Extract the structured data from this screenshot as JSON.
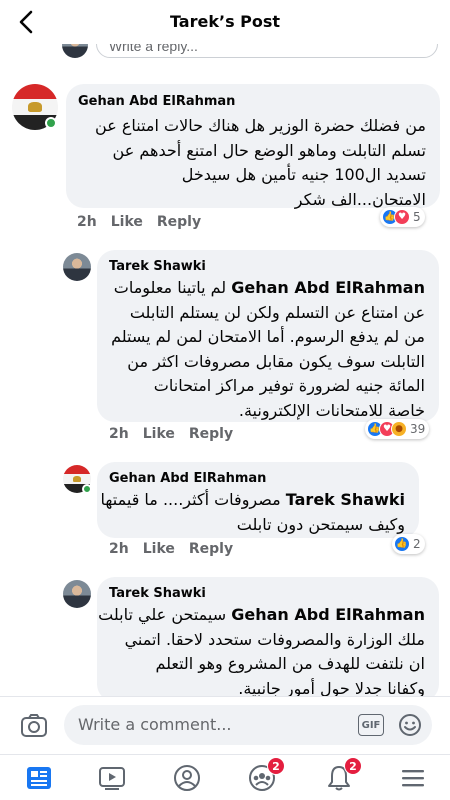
{
  "header": {
    "title": "Tarek’s Post"
  },
  "reply_box": {
    "placeholder": "Write a reply..."
  },
  "comments": [
    {
      "author": "Gehan Abd ElRahman",
      "lines": [
        "من فضلك حضرة الوزير هل هناك حالات امتناع عن",
        "تسلم التابلت وماهو الوضع حال امتنع أحدهم عن",
        "تسديد ال100 جنيه تأمين هل سيدخل",
        "الامتحان...الف شكر"
      ],
      "time": "2h",
      "like": "Like",
      "reply": "Reply",
      "reactions": "5"
    },
    {
      "author": "Tarek Shawki",
      "tag": "Gehan Abd ElRahman",
      "first_line_rest": " لم ياتينا معلومات",
      "lines": [
        "عن امتناع عن التسلم ولكن لن يستلم التابلت",
        "من لم يدفع الرسوم. أما الامتحان لمن لم يستلم",
        "التابلت سوف يكون مقابل مصروفات اكثر من",
        "المائة جنيه لضرورة توفير مراكز امتحانات",
        "خاصة للامتحانات الإلكترونية."
      ],
      "time": "2h",
      "like": "Like",
      "reply": "Reply",
      "reactions": "39"
    },
    {
      "author": "Gehan Abd ElRahman",
      "tag": "Tarek Shawki",
      "first_line_rest": "  مصروفات أكثر.... ما قيمتها",
      "lines": [
        "وكيف سيمتحن دون تابلت"
      ],
      "time": "2h",
      "like": "Like",
      "reply": "Reply",
      "reactions": "2"
    },
    {
      "author": "Tarek Shawki",
      "tag": "Gehan Abd ElRahman",
      "first_line_rest": " سيمتحن علي تابلت",
      "lines": [
        "ملك الوزارة والمصروفات ستحدد لاحقا. اتمني",
        "ان نلتفت للهدف من المشروع وهو التعلم",
        "وكفانا جدلا حول أمور جانبية."
      ]
    }
  ],
  "composer": {
    "placeholder": "Write a comment...",
    "gif": "GIF"
  },
  "tabs": {
    "groups_badge": "2",
    "notifications_badge": "2"
  },
  "colors": {
    "accent": "#1877f2",
    "like": "#1877f2",
    "love": "#f33e58",
    "badge": "#e41e3f"
  },
  "icons": [
    "back-arrow-icon",
    "camera-icon",
    "gif-icon",
    "emoji-icon",
    "news-feed-icon",
    "watch-icon",
    "profile-icon",
    "groups-icon",
    "bell-icon",
    "menu-icon"
  ]
}
